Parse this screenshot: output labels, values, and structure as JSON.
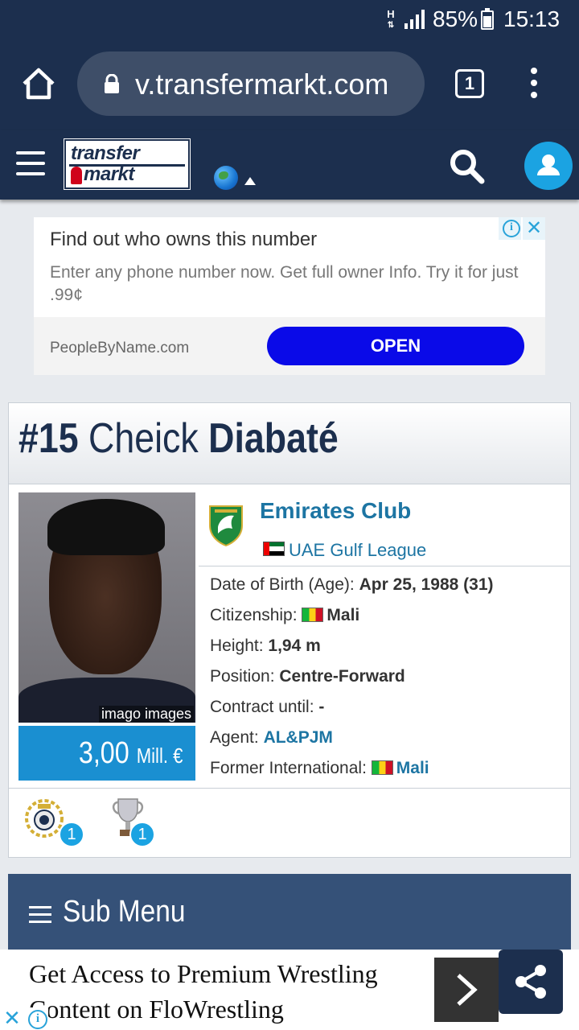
{
  "status_bar": {
    "network": "H",
    "battery": "85%",
    "time": "15:13"
  },
  "browser": {
    "url": "v.transfermarkt.com",
    "tab_count": "1"
  },
  "site": {
    "logo_line1": "transfer",
    "logo_line2": "markt"
  },
  "ad": {
    "title": "Find out who owns this number",
    "description": "Enter any phone number now. Get full owner Info. Try it for just .99¢",
    "source": "PeopleByName.com",
    "button": "OPEN"
  },
  "player": {
    "number": "#15",
    "first_name": "Cheick",
    "last_name": "Diabaté",
    "photo_credit": "imago images",
    "market_value": "3,00",
    "market_value_unit": "Mill. €",
    "club": "Emirates Club",
    "league": "UAE Gulf League",
    "details": {
      "dob_label": "Date of Birth (Age):",
      "dob_value": "Apr 25, 1988 (31)",
      "citizenship_label": "Citizenship:",
      "citizenship_value": "Mali",
      "height_label": "Height:",
      "height_value": "1,94 m",
      "position_label": "Position:",
      "position_value": "Centre-Forward",
      "contract_label": "Contract until:",
      "contract_value": "-",
      "agent_label": "Agent:",
      "agent_value": "AL&PJM",
      "former_intl_label": "Former International:",
      "former_intl_value": "Mali"
    },
    "achievements": [
      {
        "icon": "league-title-icon",
        "count": "1"
      },
      {
        "icon": "cup-trophy-icon",
        "count": "1"
      }
    ]
  },
  "submenu": {
    "label": "Sub Menu"
  },
  "bottom_ad": {
    "text": "Get Access to Premium Wrestling Content on FloWrestling"
  },
  "colors": {
    "header_bg": "#1c2f4e",
    "link": "#1d75a3",
    "value_box": "#1a8fd1",
    "badge": "#1ba3e2",
    "ad_button": "#0a0ae8",
    "submenu_bg": "#355178"
  }
}
